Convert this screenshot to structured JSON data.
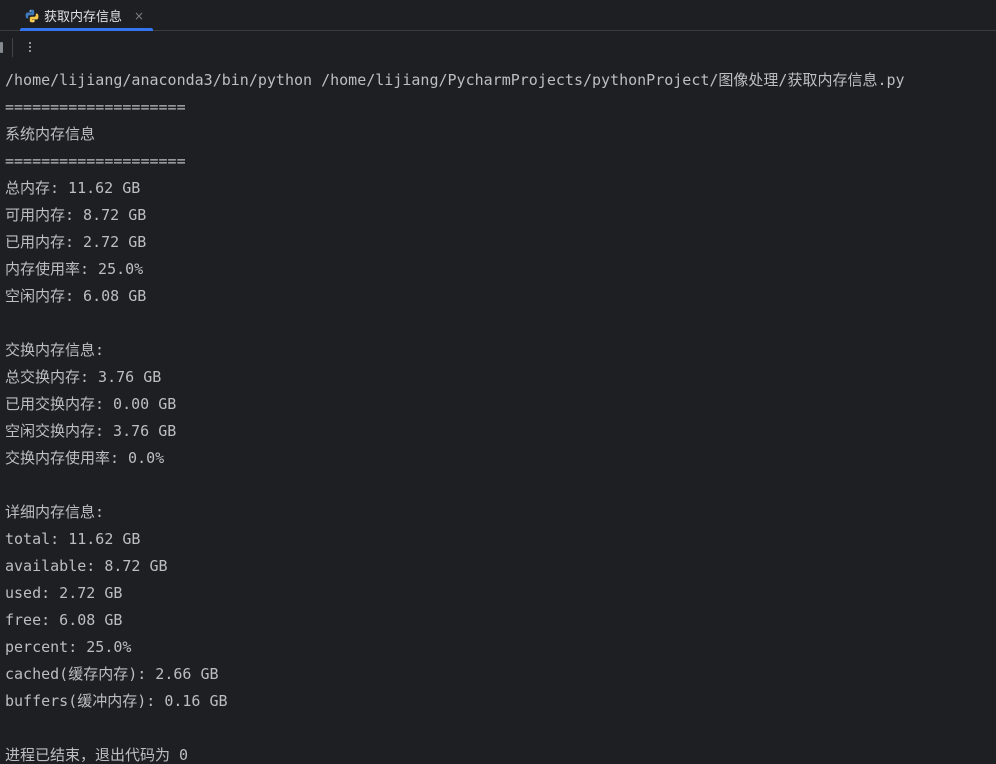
{
  "tab": {
    "title": "获取内存信息",
    "close_glyph": "×"
  },
  "toolbar": {
    "more_label": "⋮"
  },
  "console": {
    "lines": [
      "/home/lijiang/anaconda3/bin/python /home/lijiang/PycharmProjects/pythonProject/图像处理/获取内存信息.py",
      "====================",
      "系统内存信息",
      "====================",
      "总内存: 11.62 GB",
      "可用内存: 8.72 GB",
      "已用内存: 2.72 GB",
      "内存使用率: 25.0%",
      "空闲内存: 6.08 GB",
      "",
      "交换内存信息:",
      "总交换内存: 3.76 GB",
      "已用交换内存: 0.00 GB",
      "空闲交换内存: 3.76 GB",
      "交换内存使用率: 0.0%",
      "",
      "详细内存信息:",
      "total: 11.62 GB",
      "available: 8.72 GB",
      "used: 2.72 GB",
      "free: 6.08 GB",
      "percent: 25.0%",
      "cached(缓存内存): 2.66 GB",
      "buffers(缓冲内存): 0.16 GB",
      "",
      "进程已结束，退出代码为 0"
    ]
  },
  "colors": {
    "background": "#1e1f22",
    "text": "#bcbec4",
    "tab_accent": "#3574f0",
    "python_blue": "#3e7ab8",
    "python_yellow": "#f7c948"
  },
  "icons": {
    "tab_icon": "python-icon",
    "close": "close-icon",
    "more": "more-vertical-icon"
  }
}
